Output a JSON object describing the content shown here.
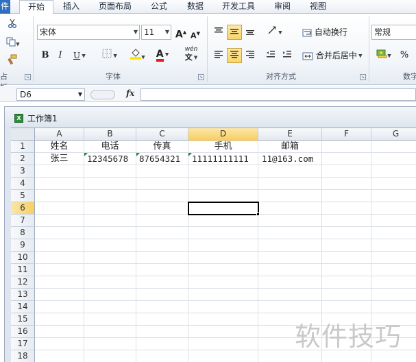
{
  "menu": {
    "file_partial": "件",
    "tabs": [
      "开始",
      "插入",
      "页面布局",
      "公式",
      "数据",
      "开发工具",
      "审阅",
      "视图"
    ],
    "active_tab": "开始"
  },
  "ribbon": {
    "clipboard_label_partial": "占板",
    "font_group_label": "字体",
    "align_group_label": "对齐方式",
    "number_group_label_partial": "数字",
    "font_name": "宋体",
    "font_size": "11",
    "bold": "B",
    "italic": "I",
    "underline": "U",
    "font_color_glyph": "A",
    "wen_glyph": "wén",
    "grow_font": "A",
    "shrink_font": "A",
    "wrap_text": "自动换行",
    "merge_center": "合并后居中",
    "number_format": "常规",
    "percent": "%",
    "colors": {
      "fill_color": "#ffe800",
      "font_color": "#e0201c",
      "pressed": "#f9d46a"
    }
  },
  "formula_bar": {
    "name_box": "D6",
    "fx": "fx",
    "formula": ""
  },
  "workbook": {
    "title": "工作簿1",
    "icon": "excel-icon"
  },
  "sheet": {
    "columns": [
      "A",
      "B",
      "C",
      "D",
      "E",
      "F",
      "G"
    ],
    "rows": [
      "1",
      "2",
      "3",
      "4",
      "5",
      "6",
      "7",
      "8",
      "9",
      "10",
      "11",
      "12",
      "13",
      "14",
      "15",
      "16",
      "17",
      "18"
    ],
    "selected_cell": "D6",
    "selected_col": "D",
    "selected_row": "6",
    "headers": {
      "a1": "姓名",
      "b1": "电话",
      "c1": "传真",
      "d1": "手机",
      "e1": "邮箱"
    },
    "row2": {
      "a2": "张三",
      "b2": "12345678",
      "c2": "87654321",
      "d2": "11111111111",
      "e2": "11@163.com"
    }
  },
  "watermark": "软件技巧"
}
